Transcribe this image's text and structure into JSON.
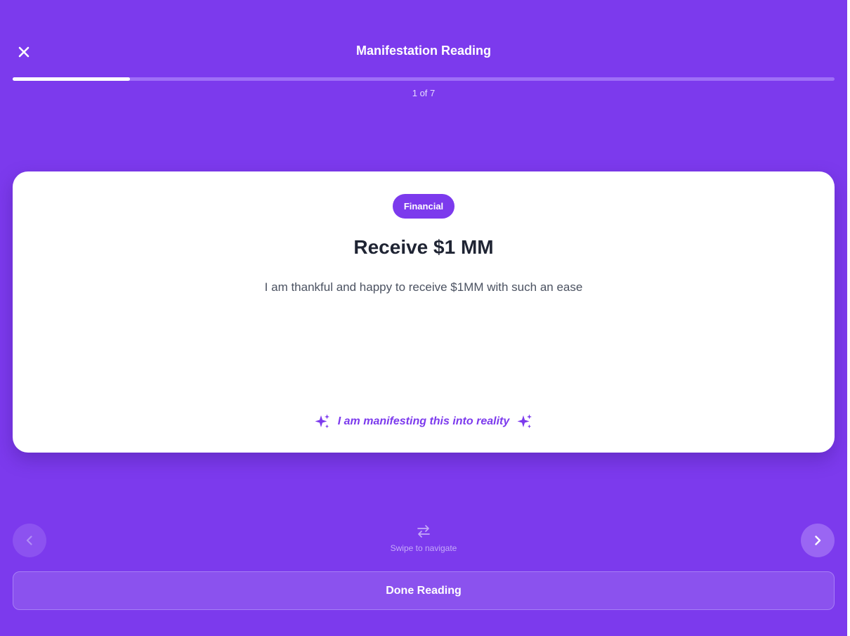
{
  "header": {
    "title": "Manifestation Reading",
    "close_icon": "close-icon"
  },
  "progress": {
    "counter": "1 of 7",
    "current": 1,
    "total": 7,
    "fraction": 0.143
  },
  "card": {
    "category": "Financial",
    "title": "Receive $1 MM",
    "description": "I am thankful and happy to receive $1MM with such an ease",
    "affirmation": "I am manifesting this into reality",
    "affirmation_icon": "sparkles-icon"
  },
  "navigation": {
    "prev_icon": "chevron-left-icon",
    "next_icon": "chevron-right-icon",
    "swipe_icon": "swap-arrows-icon",
    "swipe_hint": "Swipe to navigate"
  },
  "actions": {
    "done_label": "Done Reading"
  },
  "colors": {
    "background": "#7c3aed",
    "card": "#ffffff",
    "accent": "#7c3aed",
    "title_text": "#1f2433"
  }
}
